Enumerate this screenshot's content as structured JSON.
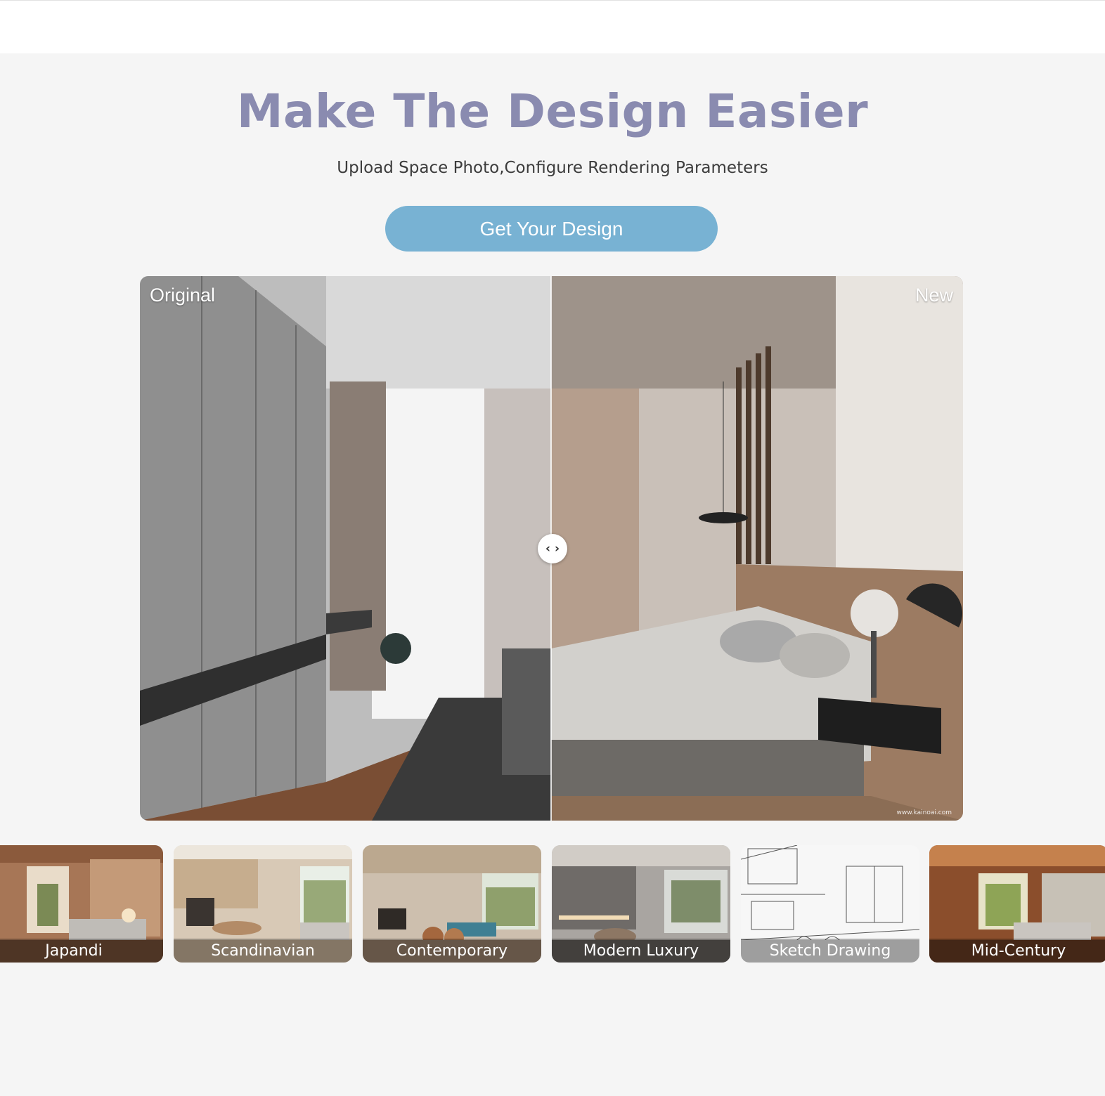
{
  "hero": {
    "title": "Make The Design Easier",
    "subtitle": "Upload Space Photo,Configure Rendering Parameters",
    "cta_label": "Get Your Design"
  },
  "compare": {
    "original_label": "Original",
    "new_label": "New",
    "handle_glyph": "‹ ›",
    "watermark": "www.kainoai.com"
  },
  "styles": [
    {
      "label": "Japandi"
    },
    {
      "label": "Scandinavian"
    },
    {
      "label": "Contemporary"
    },
    {
      "label": "Modern Luxury"
    },
    {
      "label": "Sketch Drawing"
    },
    {
      "label": "Mid-Century"
    }
  ],
  "colors": {
    "title": "#8a8bb0",
    "cta": "#78b2d3",
    "background": "#f5f5f5"
  }
}
